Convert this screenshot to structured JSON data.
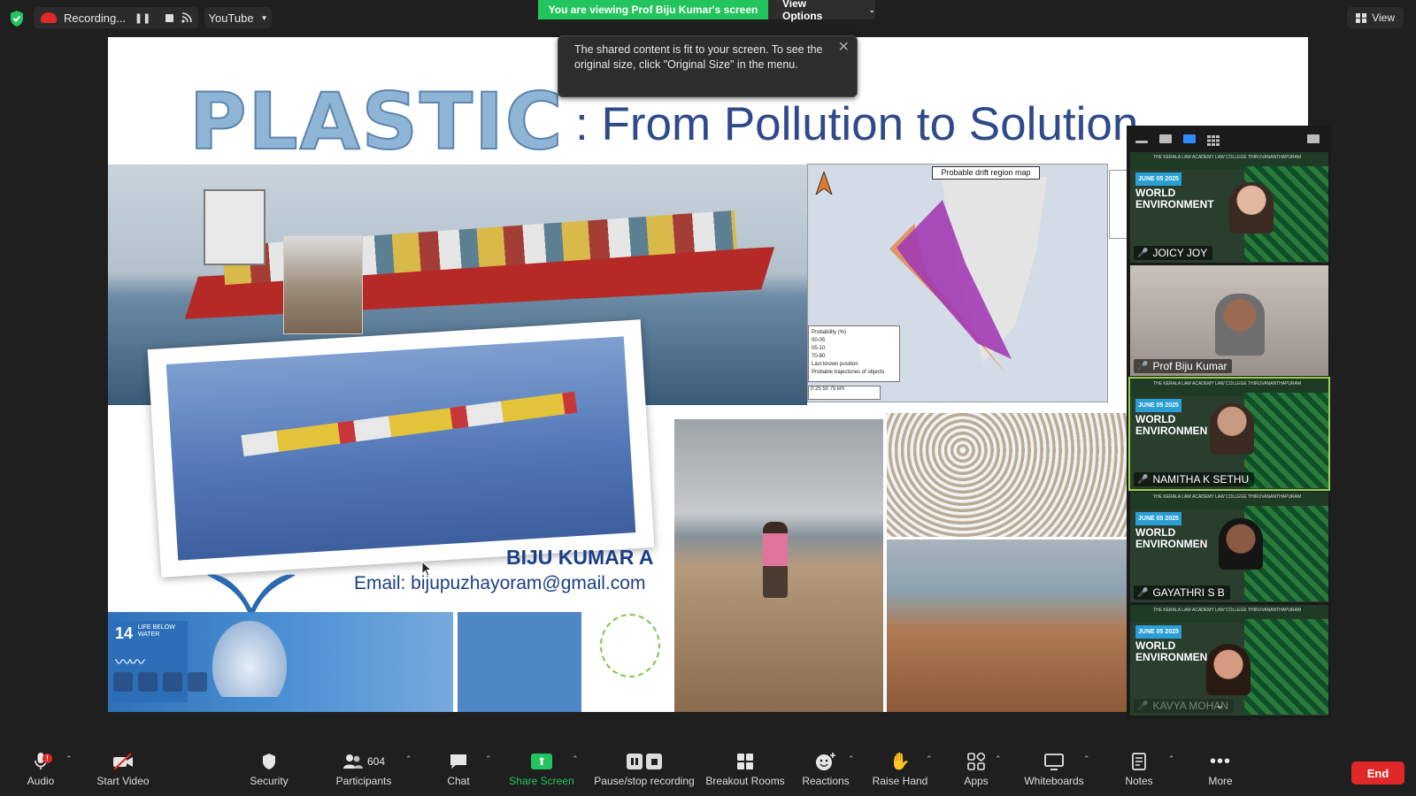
{
  "topbar": {
    "recording_label": "Recording...",
    "stream_target": "YouTube",
    "viewing_banner": "You are viewing Prof Biju Kumar's screen",
    "view_options_label": "View Options",
    "view_label": "View"
  },
  "tooltip": {
    "text": "The shared content is fit to your screen. To see the original size, click \"Original Size\" in the menu."
  },
  "slide": {
    "title_word": "PLASTIC",
    "subtitle": ": From Pollution to Solution",
    "presenter_name": "BIJU KUMAR A",
    "email": "Email: bijupuzhayoram@gmail.com",
    "sdg_number": "14",
    "sdg_text": "LIFE BELOW WATER",
    "map_title": "Probable drift region map",
    "map_legend": {
      "heading": "Probability (%)",
      "items": [
        "00-05",
        "05-10",
        "70-80",
        "Last known position",
        "Probable trajectories of objects"
      ]
    },
    "map_scale": "0    25    50    75 km"
  },
  "gallery": {
    "tiles": [
      {
        "name": "JOICY JOY",
        "date": "JUNE 05 2025",
        "line1": "WORLD",
        "line2": "ENVIRONMENT",
        "muted": true
      },
      {
        "name": "Prof Biju Kumar",
        "muted": false
      },
      {
        "name": "NAMITHA K SETHU",
        "date": "JUNE 05 2025",
        "line1": "WORLD",
        "line2": "ENVIRONMEN",
        "muted": true
      },
      {
        "name": "GAYATHRI S B",
        "date": "JUNE 05 2025",
        "line1": "WORLD",
        "line2": "ENVIRONMEN",
        "muted": true
      },
      {
        "name": "KAVYA MOHAN",
        "date": "JUNE 05 2025",
        "line1": "WORLD",
        "line2": "ENVIRONMEN",
        "muted": true
      }
    ],
    "banner_text": "THE KERALA LAW ACADEMY LAW COLLEGE THIRUVANANTHAPURAM"
  },
  "toolbar": {
    "audio": "Audio",
    "start_video": "Start Video",
    "security": "Security",
    "participants": "Participants",
    "participants_count": "604",
    "chat": "Chat",
    "share_screen": "Share Screen",
    "pause_stop": "Pause/stop recording",
    "breakout": "Breakout Rooms",
    "reactions": "Reactions",
    "raise_hand": "Raise Hand",
    "apps": "Apps",
    "whiteboards": "Whiteboards",
    "notes": "Notes",
    "more": "More",
    "end": "End",
    "audio_badge": "!"
  },
  "colors": {
    "accent_green": "#23c45e",
    "end_red": "#e02828",
    "slide_blue": "#2f4a8a",
    "speaker_highlight": "#98d14e"
  }
}
